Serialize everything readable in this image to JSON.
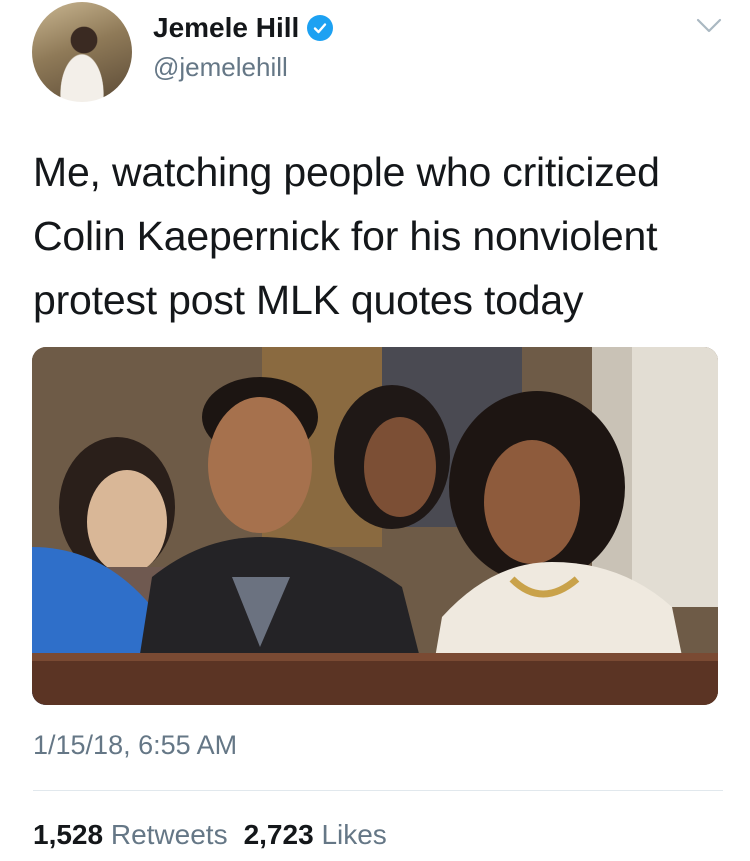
{
  "author": {
    "name": "Jemele Hill",
    "handle": "@jemelehill",
    "verified": true
  },
  "tweet": {
    "text": "Me, watching people who criticized Colin Kaepernick for his nonviolent protest post MLK quotes today",
    "timestamp": "1/15/18, 6:55 AM"
  },
  "stats": {
    "retweets_count": "1,528",
    "retweets_label": "Retweets",
    "likes_count": "2,723",
    "likes_label": "Likes"
  },
  "colors": {
    "verified_blue": "#1da1f2",
    "secondary_text": "#657786",
    "primary_text": "#14171a"
  },
  "icons": [
    "verified-badge-icon",
    "chevron-down-icon"
  ]
}
